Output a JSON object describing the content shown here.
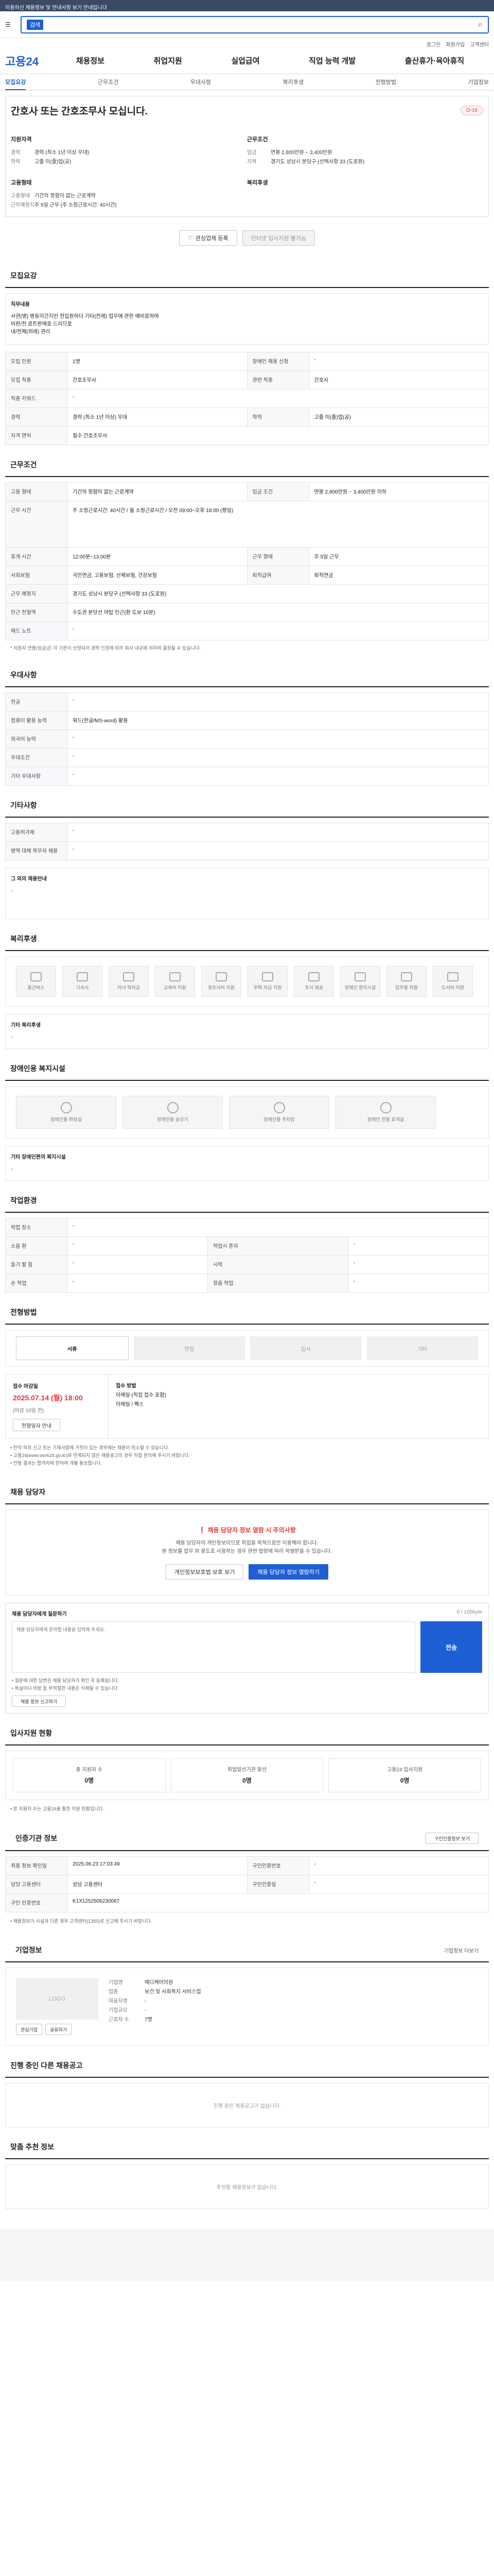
{
  "top": {
    "notice": "이용하신 채용정보 및 안내사항 보기 안내입니다"
  },
  "search": {
    "tag": "검색",
    "value": ""
  },
  "util": [
    "로그인",
    "회원가입",
    "고객센터"
  ],
  "gnb": {
    "brand": "고용24",
    "menu": [
      "채용정보",
      "취업지원",
      "실업급여",
      "직업 능력 개발",
      "출산휴가·육아휴직"
    ]
  },
  "tabs": [
    "모집요강",
    "근무조건",
    "우대사항",
    "복리후생",
    "전형방법",
    "기업정보"
  ],
  "header": {
    "title": "간호사 또는 간호조무사 모십니다.",
    "dday": "D-16"
  },
  "summary": {
    "left_title": "지원자격",
    "left": [
      {
        "k": "경력",
        "v": "경력 (최소 1년 이상 우대)"
      },
      {
        "k": "학력",
        "v": "고졸 이(졸)업(공)"
      }
    ],
    "left2_title": "고용형태",
    "left2": [
      {
        "k": "고용형태",
        "v": "기간의 정함이 없는 근로계약"
      },
      {
        "k": "근무예정지",
        "v": "주 5일 근무 (주 소정근로시간: 40시간)"
      }
    ],
    "right_title": "근무조건",
    "right": [
      {
        "k": "임금",
        "v": "연봉 2,800만원 ~ 3,400만원"
      },
      {
        "k": "지역",
        "v": "경기도 성남시 분당구 (선택사항 33 (도로원)"
      }
    ],
    "right2_title": "복리후생",
    "right2": []
  },
  "actions": {
    "interest": "관심업체 등록",
    "apply": "인터넷 입사지원 불가능"
  },
  "recruit": {
    "title": "모집요강",
    "desc_label": "직무내용",
    "desc": [
      "사관(병) 병동미간지인 전입원하다 기타(전제) 업무에 관한 예비로하여",
      "비판/전 로트판매로 드리므로",
      "내/전체(외래) 관리"
    ],
    "rows": [
      [
        {
          "k": "모집 인원",
          "v": "1명"
        },
        {
          "k": "장애인 채용 신청",
          "v": "-"
        }
      ],
      [
        {
          "k": "모집 직종",
          "v": "간호조무사"
        },
        {
          "k": "관련 직종",
          "v": "간호사"
        }
      ],
      [
        {
          "k": "직종 키워드",
          "v": "-"
        },
        {
          "k": "",
          "v": ""
        }
      ],
      [
        {
          "k": "경력",
          "v": "경력 (최소 1년 이상) 우대"
        },
        {
          "k": "학력",
          "v": "고졸 이(졸)업(공)"
        }
      ],
      [
        {
          "k": "자격 면허",
          "v": "필수  간호조무사"
        },
        {
          "k": "",
          "v": ""
        }
      ]
    ]
  },
  "work": {
    "title": "근무조건",
    "rows": [
      [
        {
          "k": "고용 형태",
          "v": "기간의 정함이 없는 근로계약"
        },
        {
          "k": "임금 조건",
          "v": "연봉 2,800만원 ~ 3,400만원 이하"
        }
      ],
      [
        {
          "k": "근무 시간",
          "v": "주 소정근로시간: 40시간 / 월 소정근로시간 / 오전 09:00~오후 18:00 (평일)"
        },
        {
          "k": "",
          "v": ""
        }
      ],
      [
        {
          "k": "휴게 시간",
          "v": "12:00분~13:00분"
        },
        {
          "k": "근무 형태",
          "v": "주 5일 근무"
        }
      ],
      [
        {
          "k": "사회보험",
          "v": "국민연금, 고용보험, 산재보험, 건강보험"
        },
        {
          "k": "퇴직급여",
          "v": "퇴직연금"
        }
      ],
      [
        {
          "k": "근무 예정지",
          "v": "경기도 성남시 분당구 (선택사항 33 (도로원)"
        },
        {
          "k": "",
          "v": ""
        }
      ],
      [
        {
          "k": "인근 전철역",
          "v": "수도권 분당선 야탑 인근(환 도보 10분)"
        },
        {
          "k": "",
          "v": ""
        }
      ],
      [
        {
          "k": "에드 노트",
          "v": "-"
        },
        {
          "k": "",
          "v": ""
        }
      ]
    ],
    "note": "* 지원자 연봉(임금)은 각 기준이 산정되어 경력 인정에 따라 회사 내규에 의하여 결정될 수 있습니다."
  },
  "prefer": {
    "title": "우대사항",
    "rows": [
      [
        {
          "k": "전공",
          "v": "-"
        }
      ],
      [
        {
          "k": "컴퓨터 활용 능력",
          "v": "워드(한글/MS-word) 활용"
        }
      ],
      [
        {
          "k": "외국어 능력",
          "v": "-"
        }
      ],
      [
        {
          "k": "우대조건",
          "v": "-"
        }
      ],
      [
        {
          "k": "기타 우대사항",
          "v": "-"
        }
      ]
    ]
  },
  "etc": {
    "title": "기타사항",
    "rows": [
      [
        {
          "k": "고용허가제",
          "v": "-"
        }
      ],
      [
        {
          "k": "병역 대체 복무자 채용",
          "v": "-"
        }
      ]
    ],
    "desc_label": "그 외의 채용안내",
    "desc": "-"
  },
  "welfare": {
    "title": "복리후생",
    "items": [
      "통근버스",
      "기숙사",
      "자녀 학자금",
      "교육비 지원",
      "경조사비 지원",
      "주택 자금 지원",
      "조식 제공",
      "장애인 편의시설",
      "업무용 차량",
      "도서비 지원"
    ],
    "desc_label": "기타 복리후생",
    "desc": "-"
  },
  "disabled": {
    "title": "장애인용 복지시설",
    "items": [
      "장애인용 화장실",
      "장애인용 승강기",
      "장애인용 주차장",
      "장애인 전용 휴게실"
    ],
    "desc_label": "기타 장애인편의 복지시설",
    "desc": "-"
  },
  "place": {
    "title": "작업환경",
    "rows": [
      [
        {
          "k": "작업 장소",
          "v": "-"
        },
        {
          "k": "",
          "v": ""
        }
      ],
      [
        {
          "k": "소음 환",
          "v": "-"
        },
        {
          "k": "작업시 혼자",
          "v": "-"
        }
      ],
      [
        {
          "k": "들기 팔 힘",
          "v": "-"
        },
        {
          "k": "시력",
          "v": "-"
        }
      ],
      [
        {
          "k": "손 작업",
          "v": "-"
        },
        {
          "k": "청음 작업",
          "v": "-"
        }
      ]
    ]
  },
  "process": {
    "title": "전형방법",
    "steps": [
      "서류",
      "면접",
      "입사",
      "기타"
    ],
    "period_label": "접수 마감일",
    "period_date": "2025.07.14 (월) 18:00",
    "period_remain": "(마감 16일 전)",
    "period_btn": "전형일자 안내",
    "method_label": "접수 방법",
    "methods": [
      "이메일 (직접 접수 포함)",
      "이메일 / 팩스"
    ],
    "bullets": [
      "• 만약 허위 신고 또는 기재사항에 거짓이 있는 경우에는 채용이 취소될 수 있습니다.",
      "• 고용24(www.work24.go.kr)와 연계되지 않은 채용공고의 경우 직접 문의해 주시기 바랍니다.",
      "• 전형 결과는 합격자에 한하여 개별 통보합니다."
    ]
  },
  "manager": {
    "title": "채용 담당자",
    "warn": "채용 담당자 정보 열람 시 주의사항",
    "desc": [
      "채용 담당자의 개인정보이므로 취업을 목적으로만 이용해야 합니다.",
      "본 정보를 업무 외 용도로 사용하는 경우 관련 법령에 따라 처벌받을 수 있습니다."
    ],
    "btn1": "개인정보보호법 보호 보기",
    "btn2": "채용 담당자 정보 열람하기",
    "inquiry_label": "채용 담당자에게 질문하기",
    "inquiry_count": "0 / 100byte",
    "inquiry_placeholder": "채용 담당자에게 문의할 내용을 입력해 주세요.",
    "send": "전송",
    "notes": [
      "• 질문에 대한 답변은 채용 담당자가 확인 후 등록됩니다.",
      "• 욕설이나 비방 등 부적절한 내용은 삭제될 수 있습니다."
    ],
    "report": "채용 정보 신고하기"
  },
  "stats": {
    "title": "입사지원 현황",
    "items": [
      {
        "label": "총 지원자 수",
        "value": "0명"
      },
      {
        "label": "취업알선기관 알선",
        "value": "0명"
      },
      {
        "label": "고용24 입사지원",
        "value": "0명"
      }
    ],
    "note": "• 본 지원자 수는 고용24를 통한 지원 현황입니다."
  },
  "info": {
    "title": "인증기관 정보",
    "btn": "구인인증정보 보기",
    "rows": [
      [
        {
          "k": "최종 정보 확인일",
          "v": "2025.06.23 17:03:49"
        },
        {
          "k": "구인인증번호",
          "v": "-"
        }
      ],
      [
        {
          "k": "담당 고용센터",
          "v": "성남 고용센터"
        },
        {
          "k": "구인인증일",
          "v": "-"
        }
      ],
      [
        {
          "k": "구인 인증번호",
          "v": "K1X1252506230067"
        },
        {
          "k": "",
          "v": ""
        }
      ]
    ],
    "note": "• 채용정보가 사실과 다른 경우 고객센터(1350)로 신고해 주시기 바랍니다."
  },
  "company": {
    "title": "기업정보",
    "more": "기업정보 더보기",
    "logo": "LOGO",
    "rows": [
      {
        "k": "기업명",
        "v": "메디케어의원"
      },
      {
        "k": "업종",
        "v": "보건 및 사회복지 서비스업"
      },
      {
        "k": "대표자명",
        "v": "-"
      },
      {
        "k": "기업규모",
        "v": "-"
      },
      {
        "k": "근로자 수",
        "v": "7명"
      }
    ],
    "btn_interest": "관심기업",
    "btn_share": "공유하기"
  },
  "more_jobs": {
    "title": "진행 중인 다른 채용공고",
    "empty": "진행 중인 채용공고가 없습니다."
  },
  "recommend": {
    "title": "맞춤 추천 정보",
    "empty": "추천할 채용정보가 없습니다."
  }
}
